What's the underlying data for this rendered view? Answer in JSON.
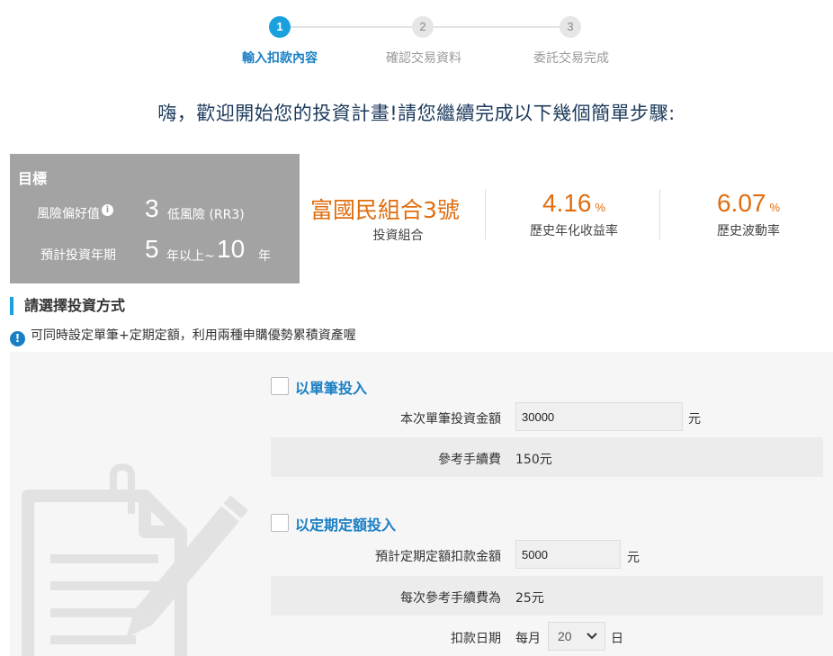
{
  "stepper": {
    "steps": [
      {
        "num": "1",
        "label": "輸入扣款內容",
        "state": "active"
      },
      {
        "num": "2",
        "label": "確認交易資料",
        "state": "inactive"
      },
      {
        "num": "3",
        "label": "委託交易完成",
        "state": "inactive"
      }
    ]
  },
  "greeting": "嗨，歡迎開始您的投資計畫!請您繼續完成以下幾個簡單步驟:",
  "goal": {
    "title": "目標",
    "risk_label": "風險偏好值",
    "risk_info_icon": "i",
    "risk_value": "3",
    "risk_text": "低風險 (RR3)",
    "period_label": "預計投資年期",
    "period_min": "5",
    "period_mid": "年以上~",
    "period_max": "10",
    "period_unit": "年"
  },
  "portfolio": {
    "name": "富國民組合3號",
    "sub": "投資組合"
  },
  "stats": [
    {
      "value": "4.16",
      "unit": "%",
      "label": "歷史年化收益率"
    },
    {
      "value": "6.07",
      "unit": "%",
      "label": "歷史波動率"
    }
  ],
  "section": {
    "title": "請選擇投資方式",
    "notice_icon": "!",
    "notice": "可同時設定單筆+定期定額，利用兩種申購優勢累積資產喔"
  },
  "single": {
    "title": "以單筆投入",
    "amount_label": "本次單筆投資金額",
    "amount_value": "30000",
    "amount_unit": "元",
    "fee_label": "參考手續費",
    "fee_value": "150元"
  },
  "regular": {
    "title": "以定期定額投入",
    "amount_label": "預計定期定額扣款金額",
    "amount_value": "5000",
    "amount_unit": "元",
    "fee_label": "每次參考手續費為",
    "fee_value": "25元",
    "date_label": "扣款日期",
    "date_prefix": "每月",
    "date_value": "20",
    "date_suffix": "日"
  },
  "colors": {
    "accent_blue": "#1aa0dc",
    "orange": "#e06d10",
    "goal_gray": "#a3a3a3"
  }
}
